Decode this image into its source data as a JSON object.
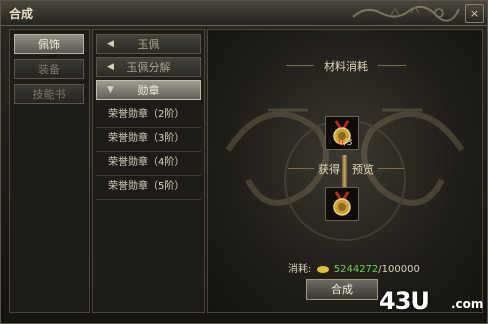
{
  "window": {
    "title": "合成",
    "close_label": "×"
  },
  "categories": [
    {
      "label": "佩饰",
      "active": true
    },
    {
      "label": "装备",
      "active": false
    },
    {
      "label": "技能书",
      "active": false
    }
  ],
  "tree": [
    {
      "label": "玉佩",
      "expanded": false
    },
    {
      "label": "玉佩分解",
      "expanded": false
    },
    {
      "label": "勋章",
      "expanded": true
    }
  ],
  "subitems": [
    "荣誉勋章（2阶）",
    "荣誉勋章（3阶）",
    "荣誉勋章（4阶）",
    "荣誉勋章（5阶）"
  ],
  "detail": {
    "material_title": "材料消耗",
    "material_count_have": "0",
    "material_count_need": "/3",
    "preview_left": "获得",
    "preview_right": "预览",
    "cost_label": "消耗:",
    "cost_current": "5244272",
    "cost_required": "/100000",
    "compose_button": "合成"
  },
  "watermark": {
    "text": "43U",
    "suffix": ".com"
  }
}
